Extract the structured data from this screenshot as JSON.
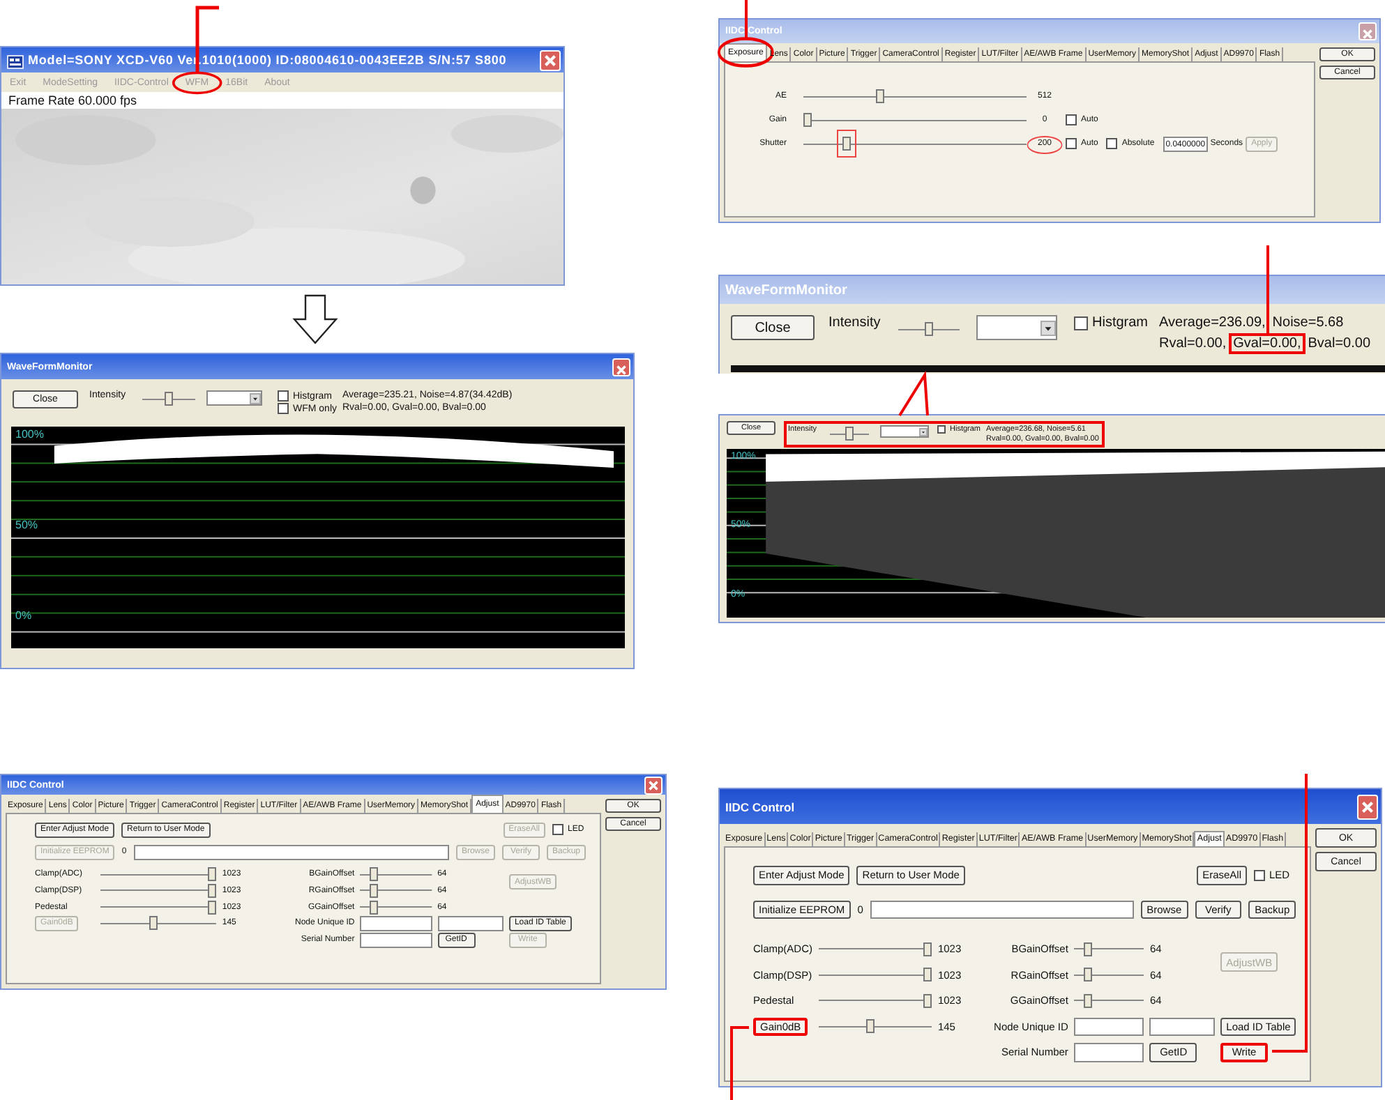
{
  "camera_window": {
    "title": "Model=SONY XCD-V60 Ver.1010(1000) ID:08004610-0043EE2B S/N:57 S800",
    "menu": [
      {
        "label": "Exit"
      },
      {
        "label": "ModeSetting"
      },
      {
        "label": "IIDC-Control"
      },
      {
        "label": "WFM",
        "highlighted": true
      },
      {
        "label": "16Bit"
      },
      {
        "label": "About"
      }
    ],
    "status": "Frame Rate 60.000 fps"
  },
  "exposure_dialog": {
    "title": "IIDC Control",
    "tabs": [
      {
        "label": "Exposure",
        "selected": true,
        "highlighted": true
      },
      {
        "label": "Lens",
        "selected": false
      },
      {
        "label": "Color",
        "selected": false
      },
      {
        "label": "Picture",
        "selected": false
      },
      {
        "label": "Trigger",
        "selected": false
      },
      {
        "label": "CameraControl",
        "selected": false
      },
      {
        "label": "Register",
        "selected": false
      },
      {
        "label": "LUT/Filter",
        "selected": false
      },
      {
        "label": "AE/AWB Frame",
        "selected": false
      },
      {
        "label": "UserMemory",
        "selected": false
      },
      {
        "label": "MemoryShot",
        "selected": false
      },
      {
        "label": "Adjust",
        "selected": false
      },
      {
        "label": "AD9970",
        "selected": false
      },
      {
        "label": "Flash",
        "selected": false
      }
    ],
    "buttons": [
      {
        "label": "OK"
      },
      {
        "label": "Cancel"
      }
    ],
    "rows": [
      {
        "label": "AE",
        "level": 0.34,
        "reading": "512"
      },
      {
        "label": "Gain",
        "level": 0.0,
        "reading": "0",
        "auto": {
          "label": "Auto",
          "checked": false
        }
      },
      {
        "label": "Shutter",
        "level": 0.18,
        "reading": "200",
        "highlighted": true,
        "auto": {
          "label": "Auto",
          "checked": false
        },
        "absolute": {
          "label": "Absolute",
          "checked": false
        },
        "seconds": {
          "value": "0.0400000",
          "unit": "Seconds"
        },
        "apply": {
          "label": "Apply",
          "disabled": true
        }
      }
    ]
  },
  "waveform_monitor": {
    "title": "WaveFormMonitor",
    "close": "Close",
    "intensity": {
      "label": "Intensity",
      "level": 0.5
    },
    "checkboxes": [
      {
        "label": "Histgram",
        "checked": false
      },
      {
        "label": "WFM only",
        "checked": false
      }
    ],
    "stats": [
      "Average=235.21, Noise=4.87(34.42dB)",
      "Rval=0.00, Gval=0.00, Bval=0.00"
    ],
    "scale": [
      "100%",
      "50%",
      "0%"
    ]
  },
  "waveform_monitor_zoom": {
    "title": "WaveFormMonitor",
    "close": "Close",
    "intensity": {
      "label": "Intensity",
      "level": 0.5
    },
    "checkboxes": [
      {
        "label": "Histgram",
        "checked": false
      }
    ],
    "stat_lines": [
      [
        {
          "text": "Average=236.09,"
        },
        {
          "text": "Noise=5.68",
          "callout": true
        }
      ],
      [
        {
          "text": "Rval=0.00,"
        },
        {
          "text": "Gval=0.00,",
          "highlighted": true
        },
        {
          "text": "Bval=0.00"
        }
      ]
    ]
  },
  "waveform_monitor_compact": {
    "close": "Close",
    "highlighted": true,
    "intensity": {
      "label": "Intensity",
      "level": 0.5
    },
    "checkboxes": [
      {
        "label": "Histgram",
        "checked": false
      }
    ],
    "stats": [
      "Average=236.68, Noise=5.61",
      "Rval=0.00, Gval=0.00, Bval=0.00"
    ],
    "scale": [
      "100%",
      "50%",
      "0%"
    ]
  },
  "adjust_dialogs": [
    {
      "title": "IIDC Control",
      "tabs": [
        {
          "label": "Exposure",
          "selected": false
        },
        {
          "label": "Lens",
          "selected": false
        },
        {
          "label": "Color",
          "selected": false
        },
        {
          "label": "Picture",
          "selected": false
        },
        {
          "label": "Trigger",
          "selected": false
        },
        {
          "label": "CameraControl",
          "selected": false
        },
        {
          "label": "Register",
          "selected": false
        },
        {
          "label": "LUT/Filter",
          "selected": false
        },
        {
          "label": "AE/AWB Frame",
          "selected": false
        },
        {
          "label": "UserMemory",
          "selected": false
        },
        {
          "label": "MemoryShot",
          "selected": false
        },
        {
          "label": "Adjust",
          "selected": true
        },
        {
          "label": "AD9970",
          "selected": false
        },
        {
          "label": "Flash",
          "selected": false
        }
      ],
      "buttons": [
        {
          "label": "OK"
        },
        {
          "label": "Cancel"
        }
      ],
      "mode_buttons": [
        {
          "label": "Enter Adjust Mode",
          "disabled": false
        },
        {
          "label": "Return to User Mode",
          "disabled": false
        }
      ],
      "erase": {
        "label": "EraseAll",
        "disabled": true
      },
      "led": {
        "label": "LED",
        "checked": false
      },
      "init": {
        "label": "Initialize EEPROM",
        "disabled": true
      },
      "init_value": "0",
      "file_buttons": [
        {
          "label": "Browse",
          "disabled": true
        },
        {
          "label": "Verify",
          "disabled": true
        },
        {
          "label": "Backup",
          "disabled": true
        }
      ],
      "sliders": [
        {
          "kind": "label",
          "label": "Clamp(ADC)",
          "level": 1.0,
          "reading": "1023"
        },
        {
          "kind": "label",
          "label": "Clamp(DSP)",
          "level": 1.0,
          "reading": "1023"
        },
        {
          "kind": "label",
          "label": "Pedestal",
          "level": 1.0,
          "reading": "1023"
        },
        {
          "kind": "button",
          "label": "Gain0dB",
          "disabled": true,
          "level": 0.45,
          "reading": "145"
        }
      ],
      "offsets": [
        {
          "label": "BGainOffset",
          "level": 0.15,
          "reading": "64"
        },
        {
          "label": "RGainOffset",
          "level": 0.15,
          "reading": "64"
        },
        {
          "label": "GGainOffset",
          "level": 0.15,
          "reading": "64"
        }
      ],
      "adjust_wb": {
        "label": "AdjustWB",
        "disabled": true
      },
      "node_id": "Node Unique ID",
      "serial": "Serial Number",
      "get_id": {
        "label": "GetID",
        "disabled": false
      },
      "load_table": {
        "label": "Load ID Table",
        "disabled": false
      },
      "write": {
        "label": "Write",
        "disabled": true
      }
    },
    {
      "title": "IIDC Control",
      "tabs": [
        {
          "label": "Exposure",
          "selected": false
        },
        {
          "label": "Lens",
          "selected": false
        },
        {
          "label": "Color",
          "selected": false
        },
        {
          "label": "Picture",
          "selected": false
        },
        {
          "label": "Trigger",
          "selected": false
        },
        {
          "label": "CameraControl",
          "selected": false
        },
        {
          "label": "Register",
          "selected": false
        },
        {
          "label": "LUT/Filter",
          "selected": false
        },
        {
          "label": "AE/AWB Frame",
          "selected": false
        },
        {
          "label": "UserMemory",
          "selected": false
        },
        {
          "label": "MemoryShot",
          "selected": false
        },
        {
          "label": "Adjust",
          "selected": true
        },
        {
          "label": "AD9970",
          "selected": false
        },
        {
          "label": "Flash",
          "selected": false
        }
      ],
      "buttons": [
        {
          "label": "OK"
        },
        {
          "label": "Cancel"
        }
      ],
      "mode_buttons": [
        {
          "label": "Enter Adjust Mode",
          "disabled": false
        },
        {
          "label": "Return to User Mode",
          "disabled": false
        }
      ],
      "erase": {
        "label": "EraseAll",
        "disabled": false
      },
      "led": {
        "label": "LED",
        "checked": false
      },
      "init": {
        "label": "Initialize EEPROM",
        "disabled": false
      },
      "init_value": "0",
      "file_buttons": [
        {
          "label": "Browse",
          "disabled": false
        },
        {
          "label": "Verify",
          "disabled": false
        },
        {
          "label": "Backup",
          "disabled": false
        }
      ],
      "sliders": [
        {
          "kind": "label",
          "label": "Clamp(ADC)",
          "level": 1.0,
          "reading": "1023"
        },
        {
          "kind": "label",
          "label": "Clamp(DSP)",
          "level": 1.0,
          "reading": "1023"
        },
        {
          "kind": "label",
          "label": "Pedestal",
          "level": 1.0,
          "reading": "1023"
        },
        {
          "kind": "button",
          "label": "Gain0dB",
          "disabled": false,
          "highlighted": true,
          "level": 0.45,
          "reading": "145"
        }
      ],
      "offsets": [
        {
          "label": "BGainOffset",
          "level": 0.15,
          "reading": "64"
        },
        {
          "label": "RGainOffset",
          "level": 0.15,
          "reading": "64"
        },
        {
          "label": "GGainOffset",
          "level": 0.15,
          "reading": "64"
        }
      ],
      "adjust_wb": {
        "label": "AdjustWB",
        "disabled": true
      },
      "node_id": "Node Unique ID",
      "serial": "Serial Number",
      "get_id": {
        "label": "GetID",
        "disabled": false
      },
      "load_table": {
        "label": "Load ID Table",
        "disabled": false
      },
      "write": {
        "label": "Write",
        "disabled": false,
        "highlighted": true
      }
    }
  ]
}
